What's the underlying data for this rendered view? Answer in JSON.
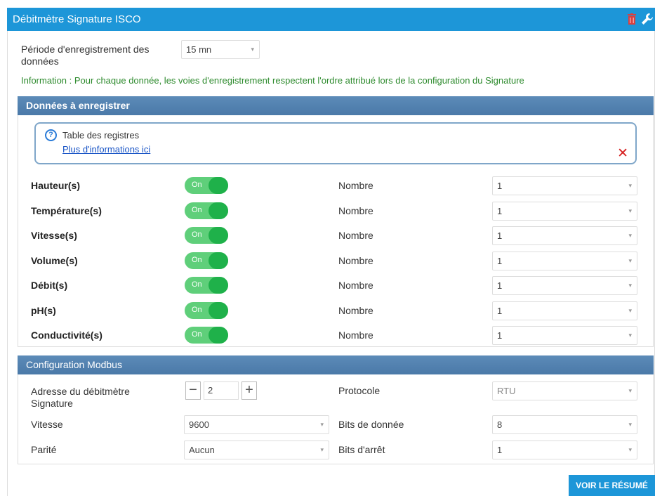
{
  "window": {
    "title": "Débitmètre Signature ISCO"
  },
  "period": {
    "label": "Période d'enregistrement des données",
    "value": "15 mn"
  },
  "info": "Information : Pour chaque donnée, les voies d'enregistrement respectent l'ordre attribué lors de la configuration du Signature",
  "data_section": {
    "title": "Données à enregistrer",
    "help": {
      "title": "Table des registres",
      "link": "Plus d'informations ici"
    },
    "toggle_on_label": "On",
    "nombre_label": "Nombre",
    "rows": [
      {
        "label": "Hauteur(s)",
        "count": "1"
      },
      {
        "label": "Température(s)",
        "count": "1"
      },
      {
        "label": "Vitesse(s)",
        "count": "1"
      },
      {
        "label": "Volume(s)",
        "count": "1"
      },
      {
        "label": "Débit(s)",
        "count": "1"
      },
      {
        "label": "pH(s)",
        "count": "1"
      },
      {
        "label": "Conductivité(s)",
        "count": "1"
      }
    ]
  },
  "modbus": {
    "title": "Configuration Modbus",
    "address_label": "Adresse du débitmètre Signature",
    "address_value": "2",
    "protocol_label": "Protocole",
    "protocol_value": "RTU",
    "speed_label": "Vitesse",
    "speed_value": "9600",
    "databits_label": "Bits de donnée",
    "databits_value": "8",
    "parity_label": "Parité",
    "parity_value": "Aucun",
    "stopbits_label": "Bits d'arrêt",
    "stopbits_value": "1"
  },
  "footer": {
    "resume_button": "VOIR LE RÉSUMÉ"
  }
}
